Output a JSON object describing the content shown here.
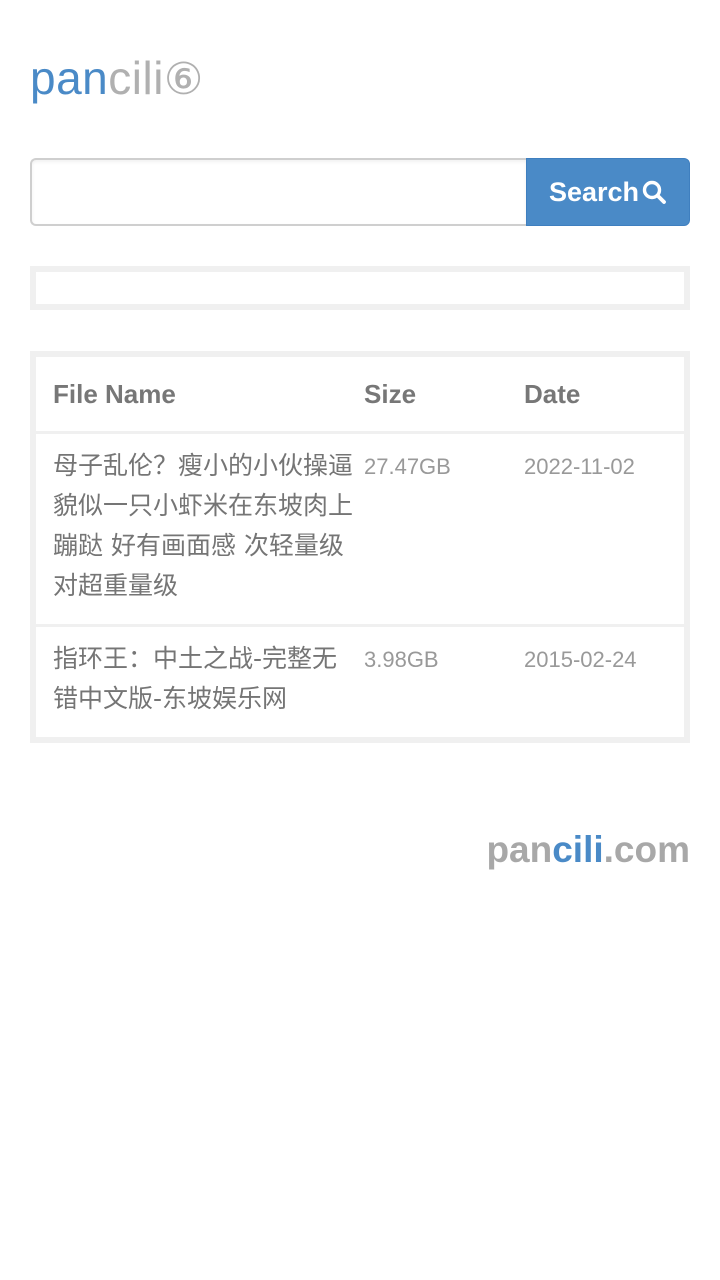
{
  "logo": {
    "part1": "pan",
    "part2": "cili",
    "part3": "⑥"
  },
  "search": {
    "value": "",
    "placeholder": "",
    "button_label": "Search",
    "button_icon": "search-icon"
  },
  "results": {
    "columns": [
      "File Name",
      "Size",
      "Date"
    ],
    "rows": [
      {
        "name": "母子乱伦？瘦小的小伙操逼貌似一只小虾米在东坡肉上蹦跶 好有画面感 次轻量级对超重量级",
        "size": "27.47GB",
        "date": "2022-11-02"
      },
      {
        "name": "指环王：中土之战-完整无错中文版-东坡娱乐网",
        "size": "3.98GB",
        "date": "2015-02-24"
      }
    ]
  },
  "footer": {
    "brand_part1": "pan",
    "brand_part2": "cili",
    "brand_part3": ".com"
  },
  "colors": {
    "accent": "#4a8ac7",
    "muted": "#b0b0b0",
    "border": "#f0f0f0"
  }
}
